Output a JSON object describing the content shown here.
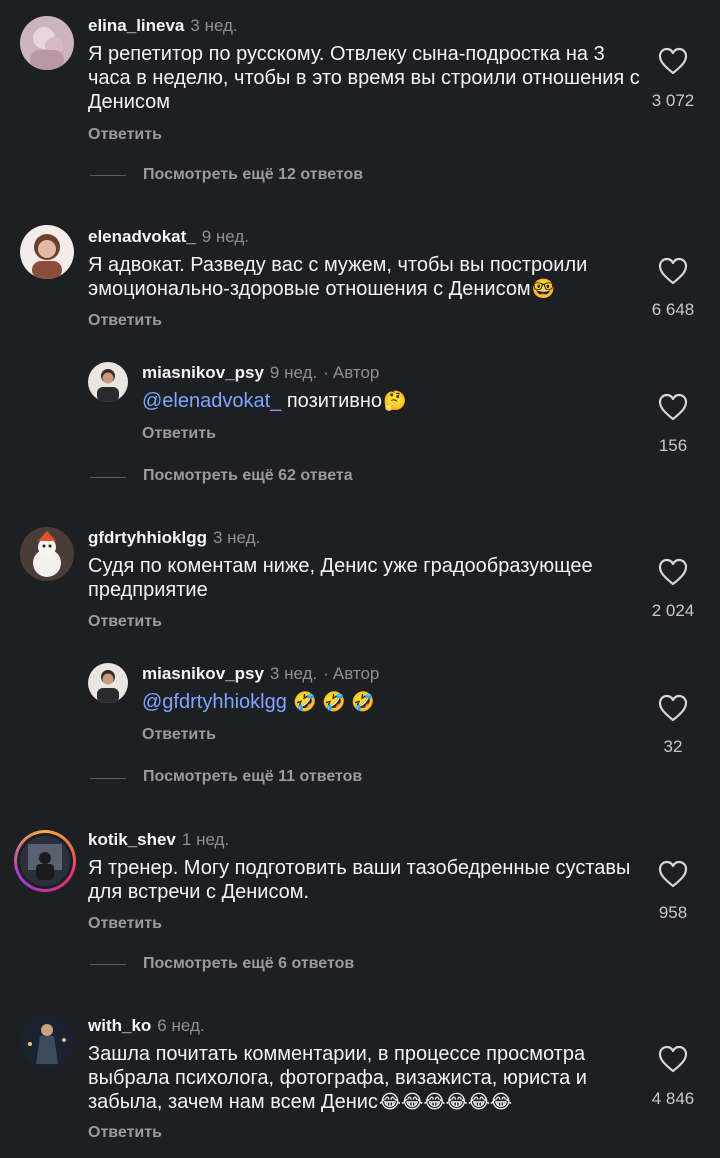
{
  "comments": [
    {
      "username": "elina_lineva",
      "time": "3 нед.",
      "text": "Я репетитор по русскому. Отвлеку сына-подростка на 3 часа в неделю, чтобы в это время вы строили отношения с Денисом",
      "likes": "3 072",
      "reply_label": "Ответить",
      "more_replies": "Посмотреть ещё 12 ответов"
    },
    {
      "username": "elenadvokat_",
      "time": "9 нед.",
      "text": "Я адвокат.  Разведу вас с мужем, чтобы вы построили эмоционально-здоровые отношения с Денисом",
      "emoji": "🤓",
      "likes": "6 648",
      "reply_label": "Ответить",
      "more_replies": "Посмотреть ещё 62 ответа",
      "reply": {
        "username": "miasnikov_psy",
        "time": "9 нед.",
        "separator": "·",
        "author_badge": "Автор",
        "mention": "@elenadvokat_",
        "text": " позитивно",
        "emoji": "🤔",
        "likes": "156",
        "reply_label": "Ответить"
      }
    },
    {
      "username": "gfdrtyhhioklgg",
      "time": "3 нед.",
      "text": "Судя по коментам ниже, Денис уже градообразующее предприятие",
      "likes": "2 024",
      "reply_label": "Ответить",
      "more_replies": "Посмотреть ещё 11 ответов",
      "reply": {
        "username": "miasnikov_psy",
        "time": "3 нед.",
        "separator": "·",
        "author_badge": "Автор",
        "mention": "@gfdrtyhhioklgg",
        "text": " ",
        "emoji": "🤣 🤣 🤣",
        "likes": "32",
        "reply_label": "Ответить"
      }
    },
    {
      "username": "kotik_shev",
      "time": "1 нед.",
      "text": "Я тренер. Могу подготовить ваши тазобедренные суставы для встречи с Денисом.",
      "likes": "958",
      "reply_label": "Ответить",
      "more_replies": "Посмотреть ещё 6 ответов"
    },
    {
      "username": "with_ko",
      "time": "6 нед.",
      "text": "Зашла почитать комментарии, в процессе просмотра выбрала психолога, фотографа, визажиста, юриста и забыла, зачем нам всем Денис",
      "emoji": "😂😂😂😂😂😂",
      "likes": "4 846",
      "reply_label": "Ответить"
    }
  ],
  "icons": {
    "like": "heart-outline-icon"
  },
  "colors": {
    "background": "#1e1f23",
    "mention": "#7ea6ff",
    "secondary_text": "#8e8e93"
  }
}
